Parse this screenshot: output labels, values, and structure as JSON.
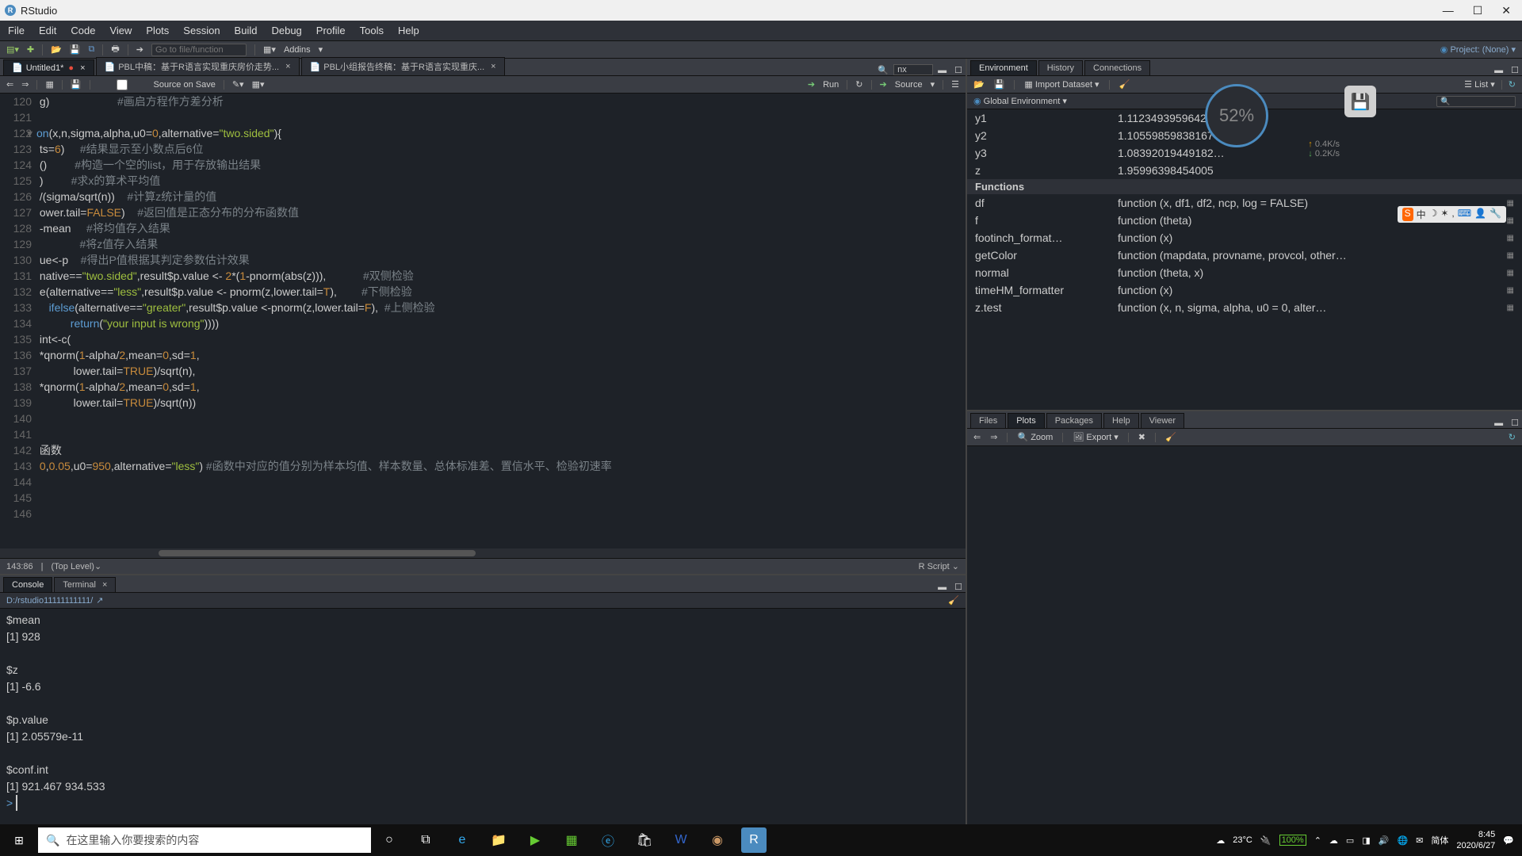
{
  "window_title": "RStudio",
  "menu": [
    "File",
    "Edit",
    "Code",
    "View",
    "Plots",
    "Session",
    "Build",
    "Debug",
    "Profile",
    "Tools",
    "Help"
  ],
  "toolbar": {
    "goto_placeholder": "Go to file/function",
    "addins_label": "Addins",
    "project_label": "Project: (None)"
  },
  "src_tabs": [
    {
      "name": "Untitled1*",
      "modified": true
    },
    {
      "name": "PBL中稿：基于R语言实现重庆房价走势...",
      "modified": false
    },
    {
      "name": "PBL小组报告终稿：基于R语言实现重庆...",
      "modified": false
    }
  ],
  "src_search": "nx",
  "src_toolbar": {
    "source_on_save": "Source on Save",
    "run": "Run",
    "source": "Source"
  },
  "code_lines": [
    {
      "n": 120,
      "raw": " g)                      #画启方程作方差分析",
      "tokens": [
        [
          " g",
          ""
        ],
        [
          ")",
          "op"
        ],
        [
          "                      ",
          ""
        ],
        [
          "#画启方程作方差分析",
          "com"
        ]
      ]
    },
    {
      "n": 121,
      "raw": "",
      "tokens": []
    },
    {
      "n": 122,
      "raw": "on(x,n,sigma,alpha,u0=0,alternative=\"two.sided\"){",
      "tokens": [
        [
          "on",
          "kw"
        ],
        [
          "(",
          "op"
        ],
        [
          "x",
          ""
        ],
        [
          ",",
          "op"
        ],
        [
          "n",
          ""
        ],
        [
          ",",
          "op"
        ],
        [
          "sigma",
          ""
        ],
        [
          ",",
          "op"
        ],
        [
          "alpha",
          ""
        ],
        [
          ",",
          "op"
        ],
        [
          "u0",
          ""
        ],
        [
          "=",
          "op"
        ],
        [
          "0",
          "num"
        ],
        [
          ",",
          "op"
        ],
        [
          "alternative",
          ""
        ],
        [
          "=",
          "op"
        ],
        [
          "\"two.sided\"",
          "str"
        ],
        [
          "){",
          "op"
        ]
      ]
    },
    {
      "n": 123,
      "raw": " ts=6)     #结果显示至小数点后6位",
      "tokens": [
        [
          " ts",
          ""
        ],
        [
          "=",
          "op"
        ],
        [
          "6",
          "num"
        ],
        [
          ")     ",
          "op"
        ],
        [
          "#结果显示至小数点后6位",
          "com"
        ]
      ]
    },
    {
      "n": 124,
      "raw": " ()         #构造一个空的list，用于存放输出结果",
      "tokens": [
        [
          " ",
          ""
        ],
        [
          "()",
          "op"
        ],
        [
          "         ",
          ""
        ],
        [
          "#构造一个空的list，用于存放输出结果",
          "com"
        ]
      ]
    },
    {
      "n": 125,
      "raw": " )         #求x的算术平均值",
      "tokens": [
        [
          " ",
          ""
        ],
        [
          ")",
          "op"
        ],
        [
          "         ",
          ""
        ],
        [
          "#求x的算术平均值",
          "com"
        ]
      ]
    },
    {
      "n": 126,
      "raw": " /(sigma/sqrt(n))    #计算z统计量的值",
      "tokens": [
        [
          " ",
          ""
        ],
        [
          "/(",
          "op"
        ],
        [
          "sigma",
          ""
        ],
        [
          "/",
          "op"
        ],
        [
          "sqrt",
          "fn"
        ],
        [
          "(",
          "op"
        ],
        [
          "n",
          ""
        ],
        [
          "))    ",
          "op"
        ],
        [
          "#计算z统计量的值",
          "com"
        ]
      ]
    },
    {
      "n": 127,
      "raw": " ower.tail=FALSE)    #返回值是正态分布的分布函数值",
      "tokens": [
        [
          " ower.tail",
          ""
        ],
        [
          "=",
          "op"
        ],
        [
          "FALSE",
          "bool"
        ],
        [
          ")    ",
          "op"
        ],
        [
          "#返回值是正态分布的分布函数值",
          "com"
        ]
      ]
    },
    {
      "n": 128,
      "raw": " -mean     #将均值存入结果",
      "tokens": [
        [
          " -mean     ",
          ""
        ],
        [
          "#将均值存入结果",
          "com"
        ]
      ]
    },
    {
      "n": 129,
      "raw": "              #将z值存入结果",
      "tokens": [
        [
          "              ",
          ""
        ],
        [
          "#将z值存入结果",
          "com"
        ]
      ]
    },
    {
      "n": 130,
      "raw": " ue<-p    #得出P值根据其判定参数估计效果",
      "tokens": [
        [
          " ue",
          ""
        ],
        [
          "<-",
          "op"
        ],
        [
          "p    ",
          ""
        ],
        [
          "#得出P值根据其判定参数估计效果",
          "com"
        ]
      ]
    },
    {
      "n": 131,
      "raw": " native==\"two.sided\",result$p.value <- 2*(1-pnorm(abs(z))),            #双侧检验",
      "tokens": [
        [
          " native",
          ""
        ],
        [
          "==",
          "op"
        ],
        [
          "\"two.sided\"",
          "str"
        ],
        [
          ",",
          "op"
        ],
        [
          "result",
          ""
        ],
        [
          "$",
          "op"
        ],
        [
          "p.value ",
          ""
        ],
        [
          "<- ",
          "op"
        ],
        [
          "2",
          "num"
        ],
        [
          "*",
          "op"
        ],
        [
          "(",
          "op"
        ],
        [
          "1",
          "num"
        ],
        [
          "-",
          "op"
        ],
        [
          "pnorm",
          "fn"
        ],
        [
          "(",
          "op"
        ],
        [
          "abs",
          "fn"
        ],
        [
          "(",
          "op"
        ],
        [
          "z",
          ""
        ],
        [
          "))),            ",
          "op"
        ],
        [
          "#双侧检验",
          "com"
        ]
      ]
    },
    {
      "n": 132,
      "raw": " e(alternative==\"less\",result$p.value <- pnorm(z,lower.tail=T),        #下侧检验",
      "tokens": [
        [
          " e",
          ""
        ],
        [
          "(",
          "op"
        ],
        [
          "alternative",
          ""
        ],
        [
          "==",
          "op"
        ],
        [
          "\"less\"",
          "str"
        ],
        [
          ",",
          "op"
        ],
        [
          "result",
          ""
        ],
        [
          "$",
          "op"
        ],
        [
          "p.value ",
          ""
        ],
        [
          "<- ",
          "op"
        ],
        [
          "pnorm",
          "fn"
        ],
        [
          "(",
          "op"
        ],
        [
          "z",
          ""
        ],
        [
          ",",
          "op"
        ],
        [
          "lower.tail",
          ""
        ],
        [
          "=",
          "op"
        ],
        [
          "T",
          "bool"
        ],
        [
          "),        ",
          "op"
        ],
        [
          "#下侧检验",
          "com"
        ]
      ]
    },
    {
      "n": 133,
      "raw": "    ifelse(alternative==\"greater\",result$p.value <-pnorm(z,lower.tail=F),  #上侧检验",
      "tokens": [
        [
          "    ",
          ""
        ],
        [
          "ifelse",
          "kw"
        ],
        [
          "(",
          "op"
        ],
        [
          "alternative",
          ""
        ],
        [
          "==",
          "op"
        ],
        [
          "\"greater\"",
          "str"
        ],
        [
          ",",
          "op"
        ],
        [
          "result",
          ""
        ],
        [
          "$",
          "op"
        ],
        [
          "p.value ",
          ""
        ],
        [
          "<-",
          "op"
        ],
        [
          "pnorm",
          "fn"
        ],
        [
          "(",
          "op"
        ],
        [
          "z",
          ""
        ],
        [
          ",",
          "op"
        ],
        [
          "lower.tail",
          ""
        ],
        [
          "=",
          "op"
        ],
        [
          "F",
          "bool"
        ],
        [
          "),  ",
          "op"
        ],
        [
          "#上侧检验",
          "com"
        ]
      ]
    },
    {
      "n": 134,
      "raw": "           return(\"your input is wrong\"))))",
      "tokens": [
        [
          "           ",
          ""
        ],
        [
          "return",
          "kw"
        ],
        [
          "(",
          "op"
        ],
        [
          "\"your input is wrong\"",
          "str"
        ],
        [
          "))))",
          "op"
        ]
      ]
    },
    {
      "n": 135,
      "raw": " int<-c(",
      "tokens": [
        [
          " int",
          ""
        ],
        [
          "<-",
          "op"
        ],
        [
          "c",
          "fn"
        ],
        [
          "(",
          "op"
        ]
      ]
    },
    {
      "n": 136,
      "raw": " *qnorm(1-alpha/2,mean=0,sd=1,",
      "tokens": [
        [
          " ",
          ""
        ],
        [
          "*",
          "op"
        ],
        [
          "qnorm",
          "fn"
        ],
        [
          "(",
          "op"
        ],
        [
          "1",
          "num"
        ],
        [
          "-",
          "op"
        ],
        [
          "alpha",
          ""
        ],
        [
          "/",
          "op"
        ],
        [
          "2",
          "num"
        ],
        [
          ",",
          "op"
        ],
        [
          "mean",
          ""
        ],
        [
          "=",
          "op"
        ],
        [
          "0",
          "num"
        ],
        [
          ",",
          "op"
        ],
        [
          "sd",
          ""
        ],
        [
          "=",
          "op"
        ],
        [
          "1",
          "num"
        ],
        [
          ",",
          "op"
        ]
      ]
    },
    {
      "n": 137,
      "raw": "            lower.tail=TRUE)/sqrt(n),",
      "tokens": [
        [
          "            lower.tail",
          ""
        ],
        [
          "=",
          "op"
        ],
        [
          "TRUE",
          "bool"
        ],
        [
          ")/",
          "op"
        ],
        [
          "sqrt",
          "fn"
        ],
        [
          "(",
          "op"
        ],
        [
          "n",
          ""
        ],
        [
          "),",
          "op"
        ]
      ]
    },
    {
      "n": 138,
      "raw": " *qnorm(1-alpha/2,mean=0,sd=1,",
      "tokens": [
        [
          " ",
          ""
        ],
        [
          "*",
          "op"
        ],
        [
          "qnorm",
          "fn"
        ],
        [
          "(",
          "op"
        ],
        [
          "1",
          "num"
        ],
        [
          "-",
          "op"
        ],
        [
          "alpha",
          ""
        ],
        [
          "/",
          "op"
        ],
        [
          "2",
          "num"
        ],
        [
          ",",
          "op"
        ],
        [
          "mean",
          ""
        ],
        [
          "=",
          "op"
        ],
        [
          "0",
          "num"
        ],
        [
          ",",
          "op"
        ],
        [
          "sd",
          ""
        ],
        [
          "=",
          "op"
        ],
        [
          "1",
          "num"
        ],
        [
          ",",
          "op"
        ]
      ]
    },
    {
      "n": 139,
      "raw": "            lower.tail=TRUE)/sqrt(n))",
      "tokens": [
        [
          "            lower.tail",
          ""
        ],
        [
          "=",
          "op"
        ],
        [
          "TRUE",
          "bool"
        ],
        [
          ")/",
          "op"
        ],
        [
          "sqrt",
          "fn"
        ],
        [
          "(",
          "op"
        ],
        [
          "n",
          ""
        ],
        [
          "))",
          "op"
        ]
      ]
    },
    {
      "n": 140,
      "raw": "",
      "tokens": []
    },
    {
      "n": 141,
      "raw": "",
      "tokens": []
    },
    {
      "n": 142,
      "raw": " 函数",
      "tokens": [
        [
          " 函数",
          ""
        ]
      ]
    },
    {
      "n": 143,
      "raw": " 0,0.05,u0=950,alternative=\"less\") #函数中对应的值分别为样本均值、样本数量、总体标准差、置信水平、检验初速率",
      "tokens": [
        [
          " ",
          ""
        ],
        [
          "0",
          "num"
        ],
        [
          ",",
          "op"
        ],
        [
          "0.05",
          "num"
        ],
        [
          ",",
          "op"
        ],
        [
          "u0",
          ""
        ],
        [
          "=",
          "op"
        ],
        [
          "950",
          "num"
        ],
        [
          ",",
          "op"
        ],
        [
          "alternative",
          ""
        ],
        [
          "=",
          "op"
        ],
        [
          "\"less\"",
          "str"
        ],
        [
          ") ",
          "op"
        ],
        [
          "#函数中对应的值分别为样本均值、样本数量、总体标准差、置信水平、检验初速率",
          "com"
        ]
      ]
    },
    {
      "n": 144,
      "raw": "",
      "tokens": []
    },
    {
      "n": 145,
      "raw": "",
      "tokens": []
    },
    {
      "n": 146,
      "raw": "",
      "tokens": []
    }
  ],
  "status": {
    "pos": "143:86",
    "scope": "(Top Level)",
    "lang": "R Script"
  },
  "console_tabs": [
    "Console",
    "Terminal"
  ],
  "console_path": "D:/rstudio11111111111/",
  "console_output": "$mean\n[1] 928\n\n$z\n[1] -6.6\n\n$p.value\n[1] 2.05579e-11\n\n$conf.int\n[1] 921.467 934.533\n",
  "console_prompt": "> ",
  "env_tabs": [
    "Environment",
    "History",
    "Connections"
  ],
  "env_toolbar": {
    "import": "Import Dataset",
    "list": "List"
  },
  "env_scope": "Global Environment",
  "env_values": [
    {
      "name": "y1",
      "val": "1.11234939596426"
    },
    {
      "name": "y2",
      "val": "1.10559859838167"
    },
    {
      "name": "y3",
      "val": "1.08392019449182…"
    },
    {
      "name": "z",
      "val": "1.95996398454005"
    }
  ],
  "env_funcs_header": "Functions",
  "env_funcs": [
    {
      "name": "df",
      "val": "function (x, df1, df2, ncp, log = FALSE)"
    },
    {
      "name": "f",
      "val": "function (theta)"
    },
    {
      "name": "footinch_format…",
      "val": "function (x)"
    },
    {
      "name": "getColor",
      "val": "function (mapdata, provname, provcol, other…"
    },
    {
      "name": "normal",
      "val": "function (theta, x)"
    },
    {
      "name": "timeHM_formatter",
      "val": "function (x)"
    },
    {
      "name": "z.test",
      "val": "function (x, n, sigma, alpha, u0 = 0, alter…"
    }
  ],
  "plots_tabs": [
    "Files",
    "Plots",
    "Packages",
    "Help",
    "Viewer"
  ],
  "plots_toolbar": {
    "zoom": "Zoom",
    "export": "Export"
  },
  "overlay": {
    "percent": "52%",
    "up": "0.4K/s",
    "down": "0.2K/s"
  },
  "taskbar": {
    "search_placeholder": "在这里输入你要搜索的内容",
    "temp": "23°C",
    "battery": "100%",
    "ime": "简体",
    "time": "8:45",
    "date": "2020/6/27"
  }
}
